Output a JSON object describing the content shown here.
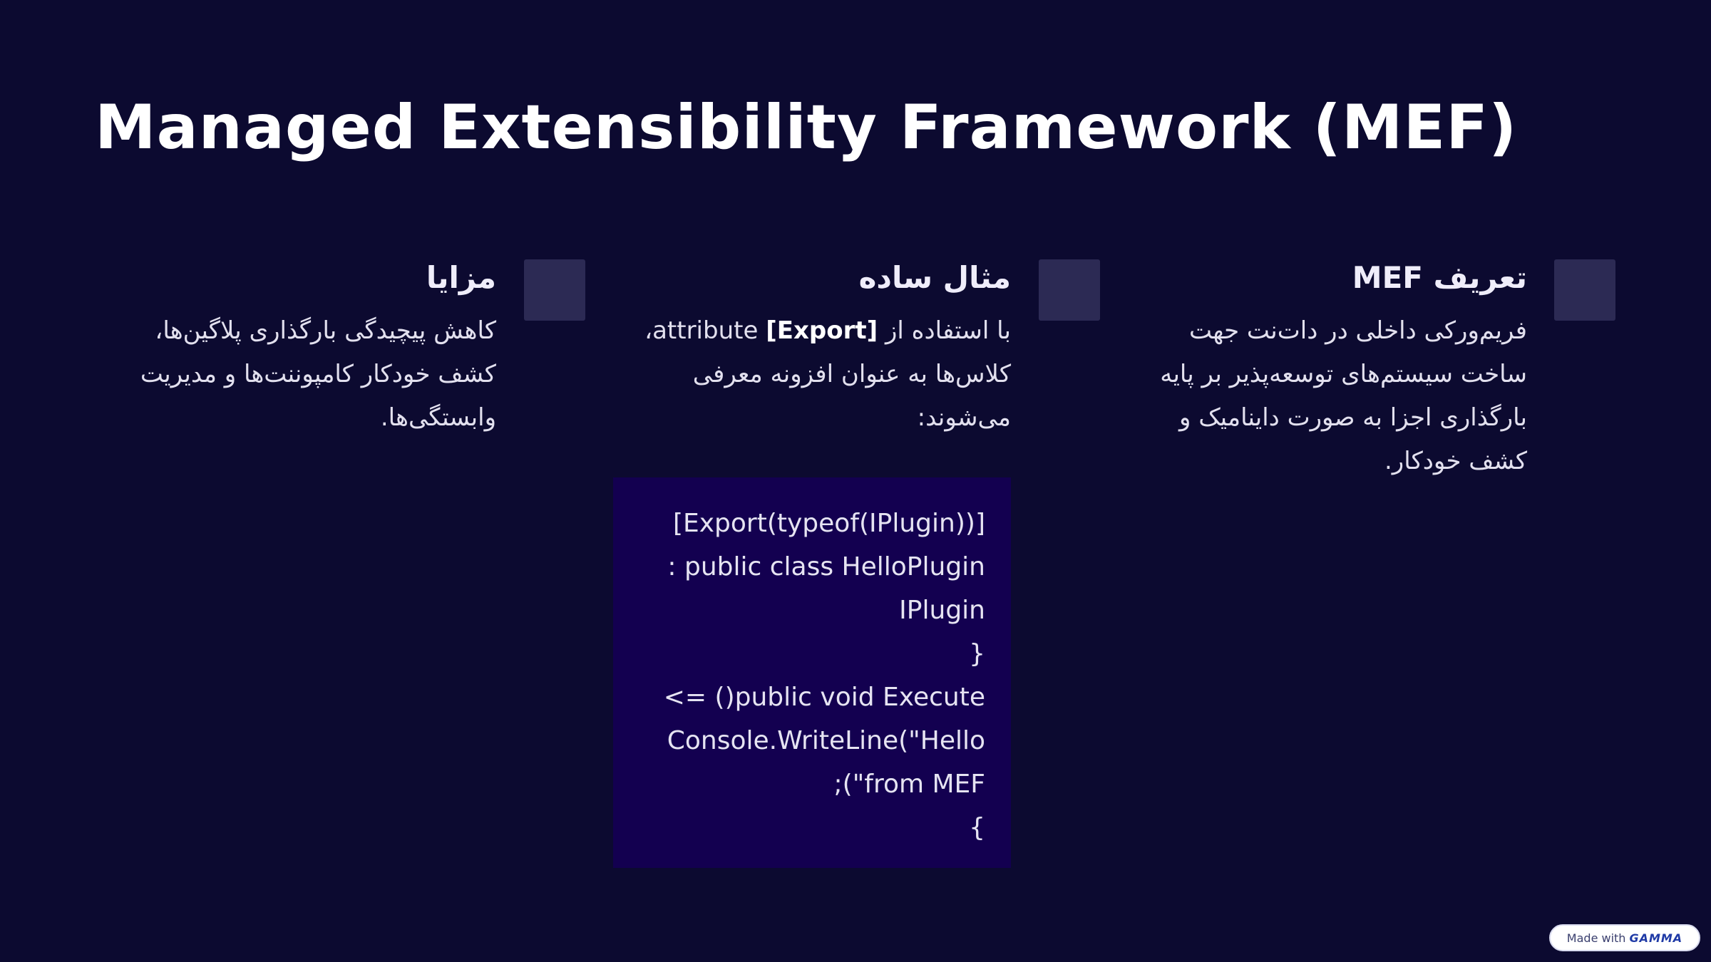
{
  "slide": {
    "title": "Managed Extensibility Framework (MEF)"
  },
  "columns": [
    {
      "heading": "تعریف MEF",
      "body_lines": [
        "فریم‌ورکی داخلی در دات‌نت جهت",
        "ساخت سیستم‌های توسعه‌پذیر بر پایه",
        "بارگذاری اجزا به صورت داینامیک و",
        "کشف خودکار."
      ]
    },
    {
      "heading": "مثال ساده",
      "body_prefix": "با استفاده از ",
      "body_bold": "[Export]",
      "body_line1_rest": " attribute،",
      "body_lines": [
        "کلاس‌ها به عنوان افزونه معرفی",
        "می‌شوند:"
      ],
      "code_lines": [
        "[Export(typeof(IPlugin))]",
        "public class HelloPlugin :",
        "IPlugin",
        "{",
        "public void Execute() =>",
        "Console.WriteLine(\"Hello",
        "from MEF\");",
        "}"
      ]
    },
    {
      "heading": "مزایا",
      "body_lines": [
        "کاهش پیچیدگی بارگذاری پلاگین‌ها،",
        "کشف خودکار کامپوننت‌ها و مدیریت",
        "وابستگی‌ها."
      ]
    }
  ],
  "badge": {
    "prefix": "Made with",
    "brand": "GAMMA"
  }
}
